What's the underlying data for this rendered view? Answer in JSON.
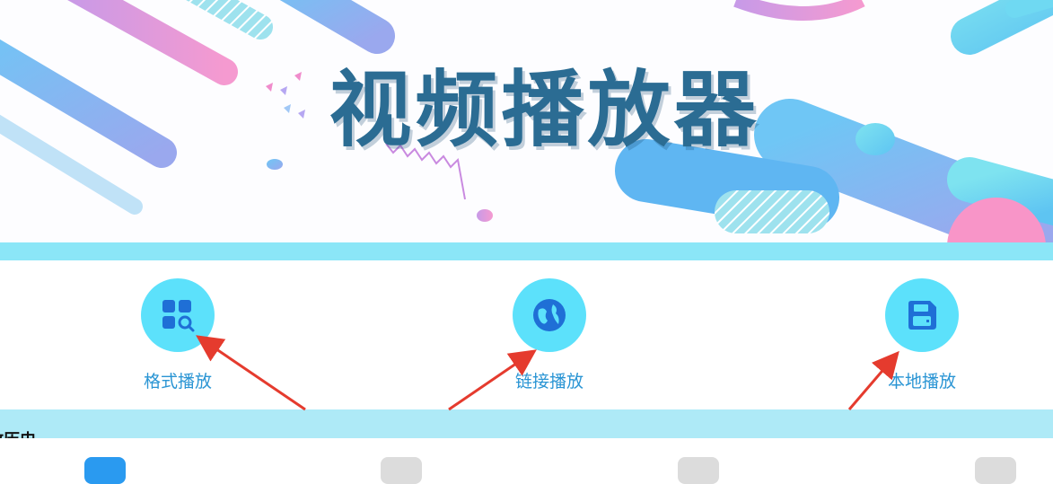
{
  "banner": {
    "title": "视频播放器"
  },
  "actions": [
    {
      "label": "格式播放",
      "icon": "apps-search-icon"
    },
    {
      "label": "链接播放",
      "icon": "globe-icon"
    },
    {
      "label": "本地播放",
      "icon": "save-icon"
    }
  ],
  "history": {
    "title": "放历史"
  },
  "tabbar": {
    "tabs": [
      {
        "icon": "home-icon",
        "active": true
      },
      {
        "icon": "search-icon",
        "active": false
      },
      {
        "icon": "briefcase-icon",
        "active": false
      },
      {
        "icon": "user-icon",
        "active": false
      }
    ]
  },
  "colors": {
    "accent": "#5ce1fb",
    "label": "#2a95d4",
    "title": "#2b6c93",
    "strip": "#8be6f7",
    "history_bar": "#aeeaf7",
    "active_tab": "#2a9af0",
    "arrow": "#e53b2e"
  }
}
